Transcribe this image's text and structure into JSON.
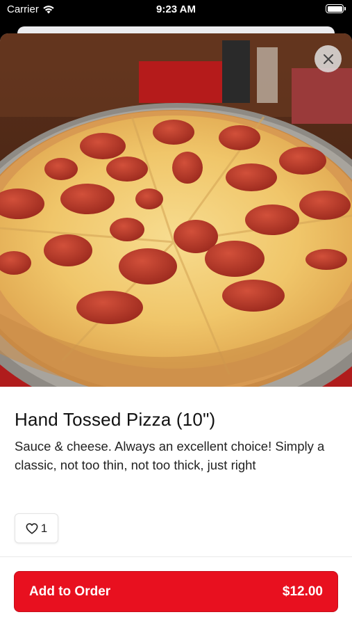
{
  "status_bar": {
    "carrier": "Carrier",
    "time": "9:23 AM",
    "icons": [
      "wifi-icon",
      "battery-icon"
    ]
  },
  "item": {
    "title": "Hand Tossed Pizza (10\")",
    "description": "Sauce & cheese. Always an excellent choice! Simply a classic, not too thin, not too thick, just right",
    "image": "pepperoni-pizza-photo",
    "likes": "1"
  },
  "actions": {
    "close_icon": "close-icon",
    "like_icon": "heart-icon",
    "add_label": "Add to Order",
    "price": "$12.00"
  },
  "colors": {
    "accent": "#e8101f",
    "text": "#111111",
    "background": "#ffffff"
  }
}
